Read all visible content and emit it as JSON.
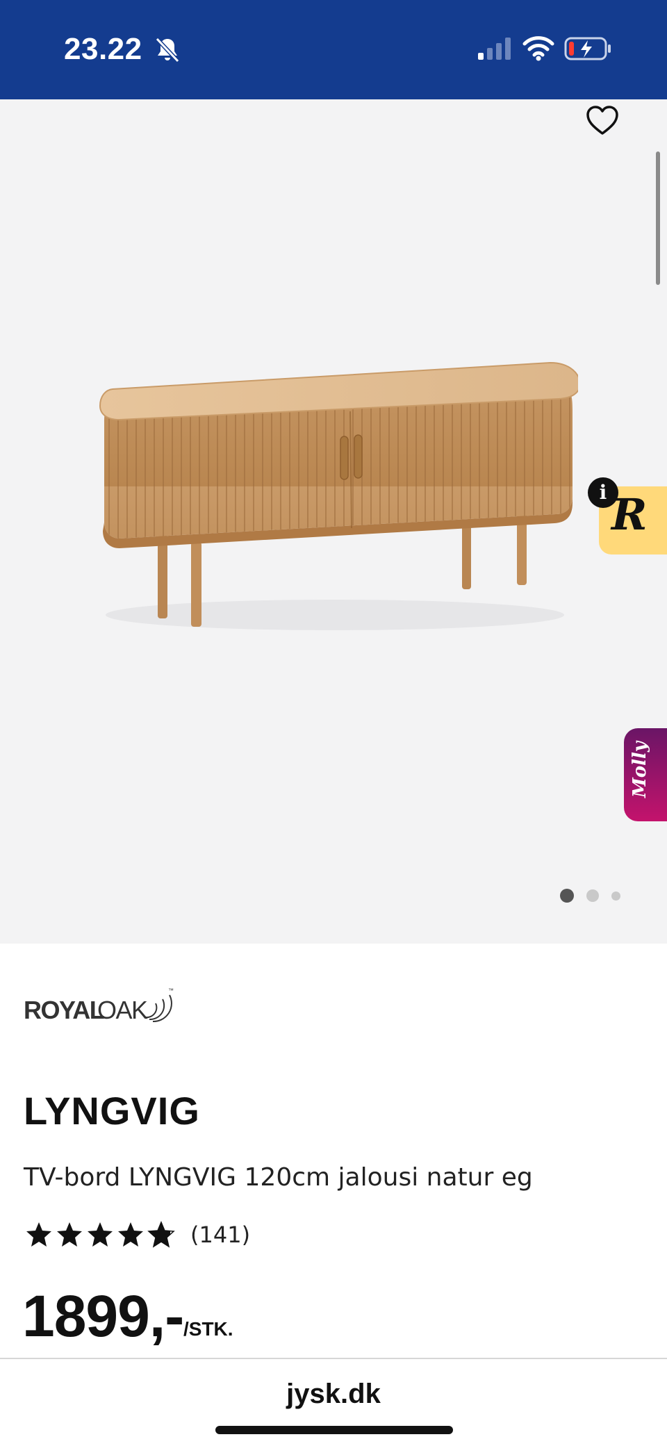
{
  "status_bar": {
    "time": "23.22",
    "bell_icon": "bell-slash-icon",
    "signal_icon": "cellular-signal-icon",
    "wifi_icon": "wifi-icon",
    "battery_icon": "battery-charging-icon",
    "background": "#143c8f"
  },
  "gallery": {
    "favorite_icon": "heart-outline-icon",
    "badge_r_letter": "R",
    "badge_info": "i",
    "molly_label": "Molly",
    "slide_count": 3,
    "active_slide": 1
  },
  "brand": {
    "name_bold": "ROYAL",
    "name_light": "OAK",
    "tm": "™"
  },
  "product": {
    "title": "LYNGVIG",
    "subtitle": "TV-bord LYNGVIG 120cm jalousi natur eg",
    "rating": 4.8,
    "review_count": "(141)",
    "price": "1899,-",
    "price_unit": "/STK."
  },
  "browser": {
    "url": "jysk.dk"
  }
}
